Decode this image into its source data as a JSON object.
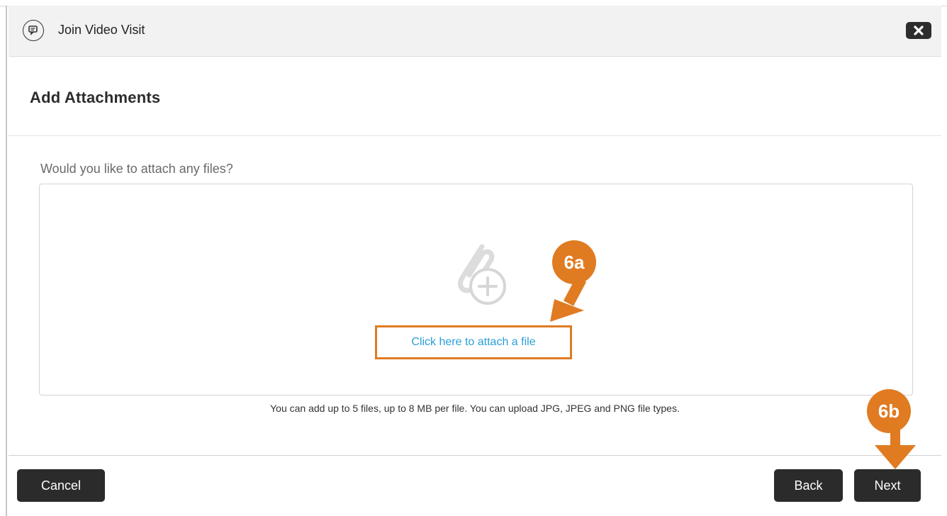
{
  "dialog": {
    "title": "Join Video Visit",
    "header_icon": "chat-bubbles-icon",
    "close_icon": "close-icon"
  },
  "section": {
    "title": "Add Attachments"
  },
  "attachments": {
    "question": "Would you like to attach any files?",
    "dropzone_icon": "paperclip-plus-icon",
    "attach_link": "Click here to attach a file",
    "hint": "You can add up to 5 files, up to 8 MB per file. You can upload JPG, JPEG and PNG file types."
  },
  "footer": {
    "cancel_label": "Cancel",
    "back_label": "Back",
    "next_label": "Next"
  },
  "annotations": {
    "callout_a": "6a",
    "callout_b": "6b",
    "color": "#e07b22"
  },
  "colors": {
    "link": "#2a9fd6",
    "button_bg": "#2b2b2b",
    "header_bg": "#f2f2f2"
  }
}
